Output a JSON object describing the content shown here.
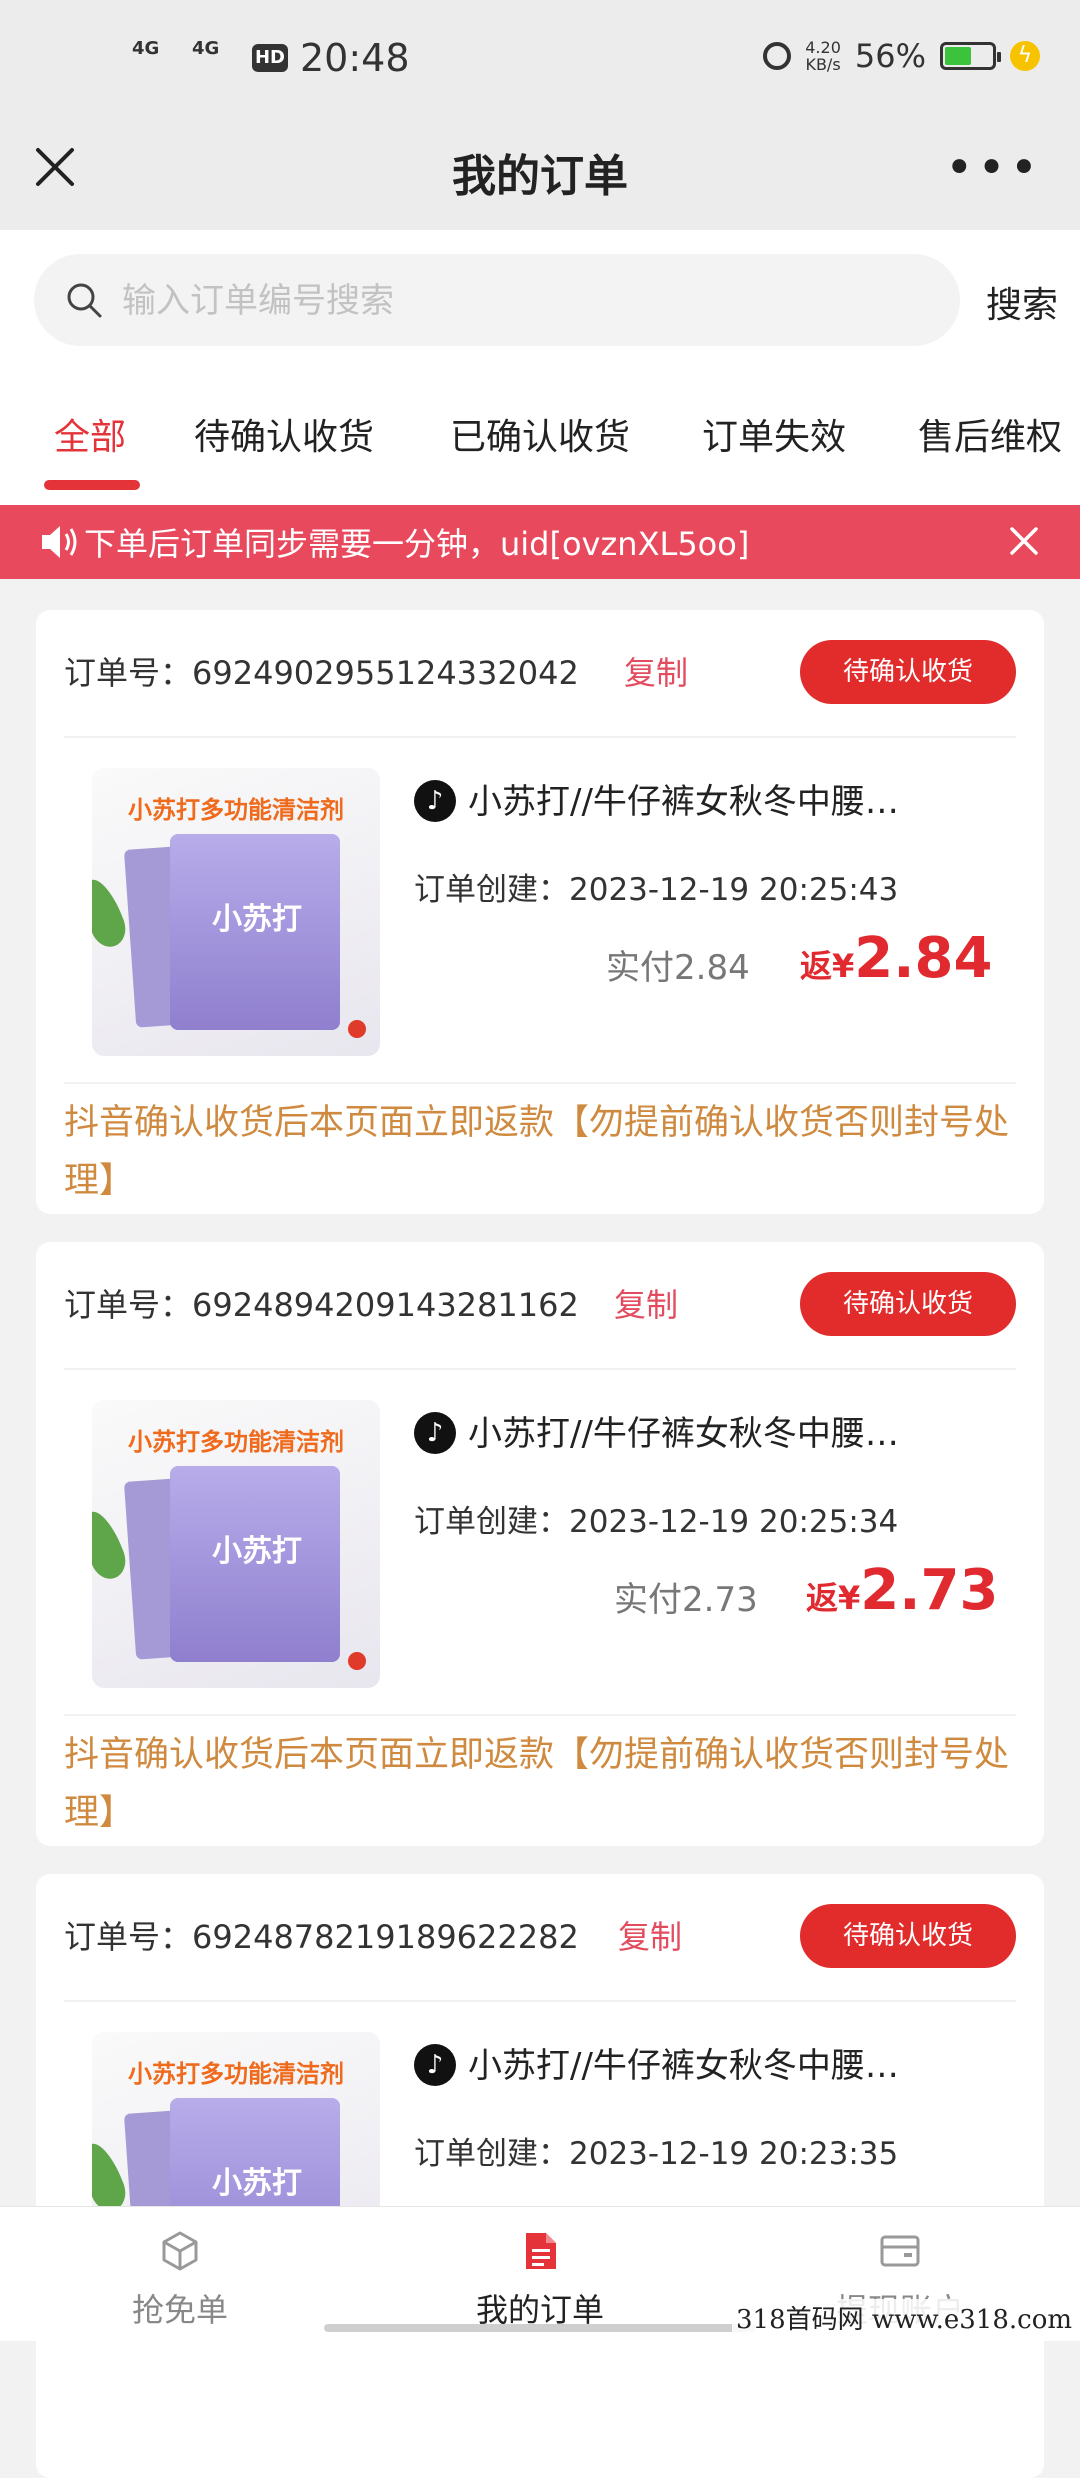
{
  "status_bar": {
    "time": "20:48",
    "signal1": "4G",
    "signal2": "4G",
    "hd": "HD",
    "net_speed_value": "4.20",
    "net_speed_unit": "KB/s",
    "battery_percent": "56%",
    "battery_level": 0.56
  },
  "header": {
    "title": "我的订单",
    "more": "•••"
  },
  "search": {
    "placeholder": "输入订单编号搜索",
    "value": "",
    "button_label": "搜索"
  },
  "tabs": [
    {
      "label": "全部",
      "active": true
    },
    {
      "label": "待确认收货",
      "active": false
    },
    {
      "label": "已确认收货",
      "active": false
    },
    {
      "label": "订单失效",
      "active": false
    },
    {
      "label": "售后维权",
      "active": false
    }
  ],
  "notice": {
    "text": "下单后订单同步需要一分钟，uid[ovznXL5oo]"
  },
  "orders": [
    {
      "order_label": "订单号：6924902955124332042",
      "copy_label": "复制",
      "status": "待确认收货",
      "image_banner": "小苏打多功能清洁剂",
      "image_label": "小苏打",
      "product_name": "小苏打//牛仔裤女秋冬中腰…",
      "created": "订单创建：2023-12-19 20:25:43",
      "paid": "实付2.84",
      "rebate_prefix": "返¥",
      "rebate_amount": "2.84",
      "warning": "抖音确认收货后本页面立即返款【勿提前确认收货否则封号处理】"
    },
    {
      "order_label": "订单号：6924894209143281162",
      "copy_label": "复制",
      "status": "待确认收货",
      "image_banner": "小苏打多功能清洁剂",
      "image_label": "小苏打",
      "product_name": "小苏打//牛仔裤女秋冬中腰…",
      "created": "订单创建：2023-12-19 20:25:34",
      "paid": "实付2.73",
      "rebate_prefix": "返¥",
      "rebate_amount": "2.73",
      "warning": "抖音确认收货后本页面立即返款【勿提前确认收货否则封号处理】"
    },
    {
      "order_label": "订单号：6924878219189622282",
      "copy_label": "复制",
      "status": "待确认收货",
      "image_banner": "小苏打多功能清洁剂",
      "image_label": "小苏打",
      "product_name": "小苏打//牛仔裤女秋冬中腰…",
      "created": "订单创建：2023-12-19 20:23:35",
      "paid": "",
      "rebate_prefix": "",
      "rebate_amount": "",
      "warning": ""
    }
  ],
  "bottom_nav": [
    {
      "label": "抢免单",
      "icon": "cube-icon",
      "active": false
    },
    {
      "label": "我的订单",
      "icon": "document-icon",
      "active": true
    },
    {
      "label": "提现账户",
      "icon": "wallet-icon",
      "active": false
    }
  ],
  "watermark": "318首码网 www.e318.com",
  "colors": {
    "accent": "#e5333a",
    "notice_bg": "#e8495d",
    "warning_text": "#cf8a3f",
    "status_button": "#e22b2b"
  }
}
